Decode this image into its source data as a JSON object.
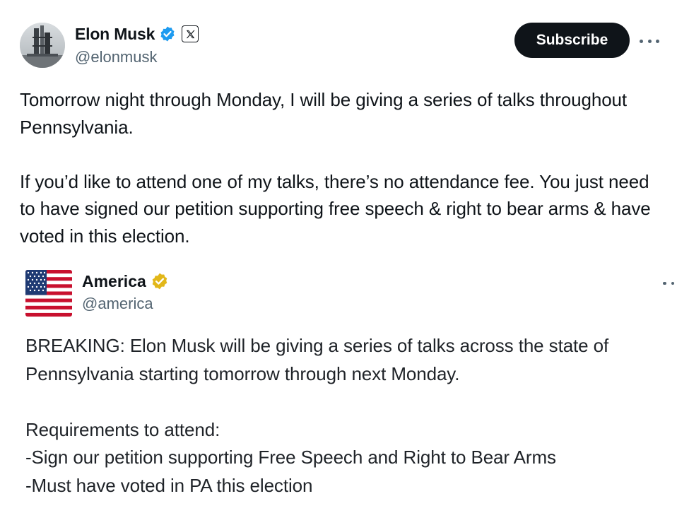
{
  "post": {
    "author": {
      "name": "Elon Musk",
      "handle": "@elonmusk"
    },
    "subscribe_label": "Subscribe",
    "text_paragraphs": [
      "Tomorrow night through Monday, I will be giving a series of talks throughout Pennsylvania.",
      "If you’d like to attend one of my talks, there’s no attendance fee. You just need to have signed our petition supporting free speech & right to bear arms & have voted in this election."
    ]
  },
  "quote": {
    "author": {
      "name": "America",
      "handle": "@america"
    },
    "text": {
      "line1": "BREAKING: Elon Musk will be giving a series of talks across the state of Pennsylvania starting tomorrow through next Monday.",
      "requirements_title": "Requirements to attend:",
      "requirement1": "-Sign our petition supporting Free Speech and Right to Bear Arms",
      "requirement2": "-Must have voted in PA this election"
    }
  },
  "icons": {
    "verified_badge": "blue-check-badge",
    "affiliate_badge": "x-logo",
    "org_badge": "gold-check-badge",
    "more": "ellipsis"
  },
  "colors": {
    "verified_blue": "#1d9bf0",
    "gold": "#e2b719",
    "button_bg": "#0f1419",
    "secondary_text": "#536471"
  }
}
